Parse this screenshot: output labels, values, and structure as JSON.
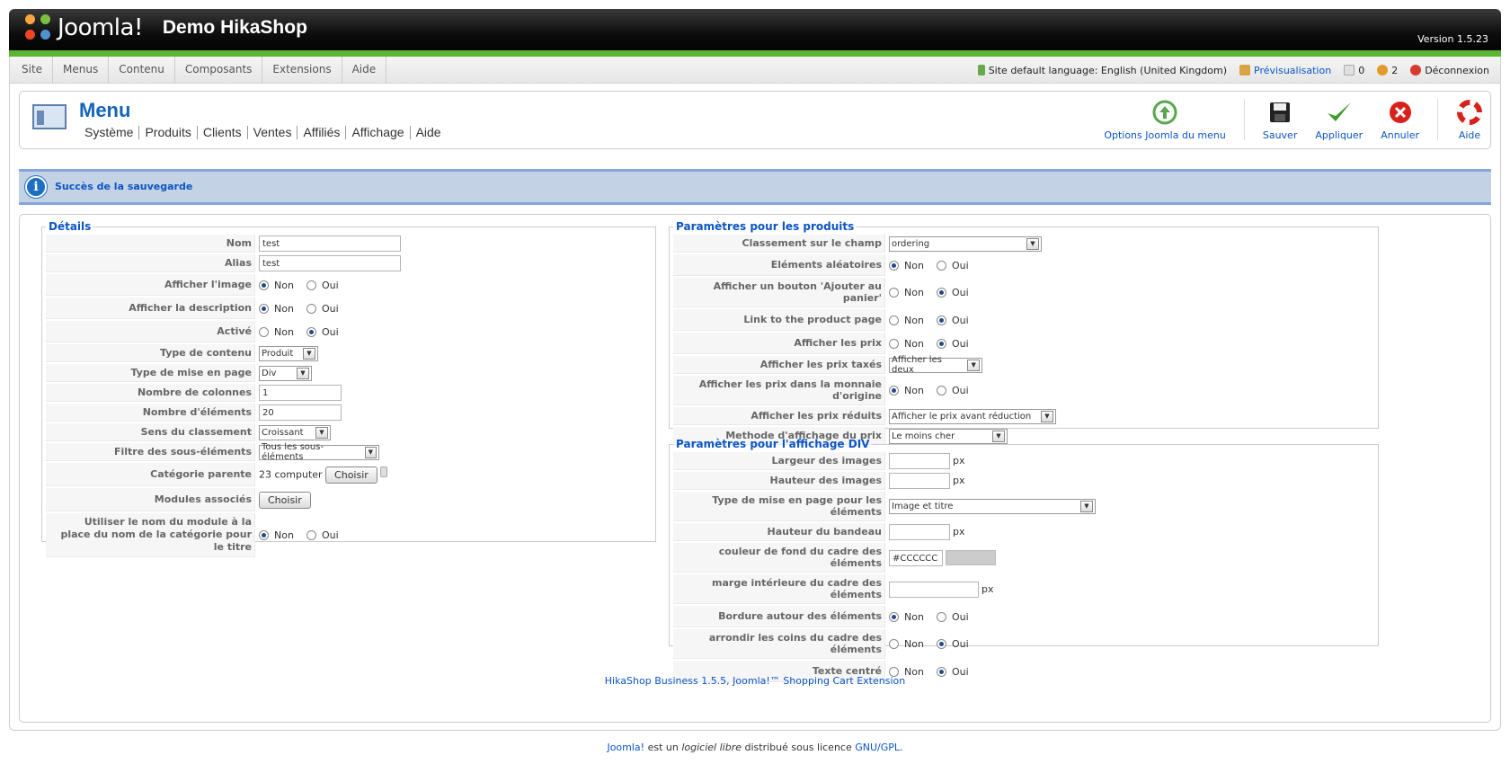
{
  "header": {
    "logo_text": "Joomla!",
    "site_name": "Demo HikaShop",
    "version": "Version 1.5.23"
  },
  "menubar": {
    "items": [
      "Site",
      "Menus",
      "Contenu",
      "Composants",
      "Extensions",
      "Aide"
    ],
    "language": "Site default language: English (United Kingdom)",
    "preview": "Prévisualisation",
    "messages_count": "0",
    "users_count": "2",
    "logout": "Déconnexion"
  },
  "toolbar": {
    "title": "Menu",
    "submenu": [
      "Système",
      "Produits",
      "Clients",
      "Ventes",
      "Affiliés",
      "Affichage",
      "Aide"
    ],
    "buttons": {
      "joomla_options": "Options Joomla du menu",
      "save": "Sauver",
      "apply": "Appliquer",
      "cancel": "Annuler",
      "help": "Aide"
    }
  },
  "message": "Succès de la sauvegarde",
  "details": {
    "legend": "Détails",
    "nom_label": "Nom",
    "nom_value": "test",
    "alias_label": "Alias",
    "alias_value": "test",
    "afficher_image_label": "Afficher l'image",
    "afficher_description_label": "Afficher la description",
    "active_label": "Activé",
    "type_contenu_label": "Type de contenu",
    "type_contenu_value": "Produit",
    "type_mise_en_page_label": "Type de mise en page",
    "type_mise_en_page_value": "Div",
    "nb_colonnes_label": "Nombre de colonnes",
    "nb_colonnes_value": "1",
    "nb_elements_label": "Nombre d'éléments",
    "nb_elements_value": "20",
    "sens_classement_label": "Sens du classement",
    "sens_classement_value": "Croissant",
    "filtre_label": "Filtre des sous-éléments",
    "filtre_value": "Tous les sous-éléments",
    "categorie_parente_label": "Catégorie parente",
    "categorie_parente_value": "23 computer",
    "choisir": "Choisir",
    "modules_label": "Modules associés",
    "utiliser_nom_label_1": "Utiliser le nom du module à la",
    "utiliser_nom_label_2": "place du nom de la catégorie pour le titre"
  },
  "radio": {
    "non": "Non",
    "oui": "Oui"
  },
  "produits": {
    "legend": "Paramètres pour les produits",
    "classement_label": "Classement sur le champ",
    "classement_value": "ordering",
    "aleatoires_label": "Eléments aléatoires",
    "ajouter_panier_label": "Afficher un bouton 'Ajouter au panier'",
    "link_product_label": "Link to the product page",
    "afficher_prix_label": "Afficher les prix",
    "prix_taxes_label": "Afficher les prix taxés",
    "prix_taxes_value": "Afficher les deux",
    "monnaie_origine_label": "Afficher les prix dans la monnaie d'origine",
    "prix_reduits_label": "Afficher les prix réduits",
    "prix_reduits_value": "Afficher le prix avant réduction",
    "methode_affichage_label": "Methode d'affichage du prix",
    "methode_affichage_value": "Le moins cher"
  },
  "div": {
    "legend": "Paramètres pour l'affichage DIV",
    "largeur_label": "Largeur des images",
    "hauteur_label": "Hauteur des images",
    "type_mise_en_page_label": "Type de mise en page pour les éléments",
    "type_mise_en_page_value": "Image et titre",
    "hauteur_bandeau_label": "Hauteur du bandeau",
    "couleur_fond_label": "couleur de fond du cadre des éléments",
    "couleur_fond_value": "#CCCCCC",
    "marge_label": "marge intérieure du cadre des éléments",
    "bordure_label": "Bordure autour des éléments",
    "arrondir_label": "arrondir les coins du cadre des éléments",
    "texte_centre_label": "Texte centré",
    "px": "px"
  },
  "footer": {
    "extension": "HikaShop Business 1.5.5, Joomla!™ Shopping Cart Extension",
    "joomla": "Joomla!",
    "middle1": " est un ",
    "libre": "logiciel libre",
    "middle2": " distribué sous licence ",
    "license": "GNU/GPL",
    "end": "."
  },
  "colors": {
    "accent_green": "#5bb531",
    "link_blue": "#0b55c4",
    "title_blue": "#1564b8",
    "message_bg": "#c3d2e5"
  }
}
